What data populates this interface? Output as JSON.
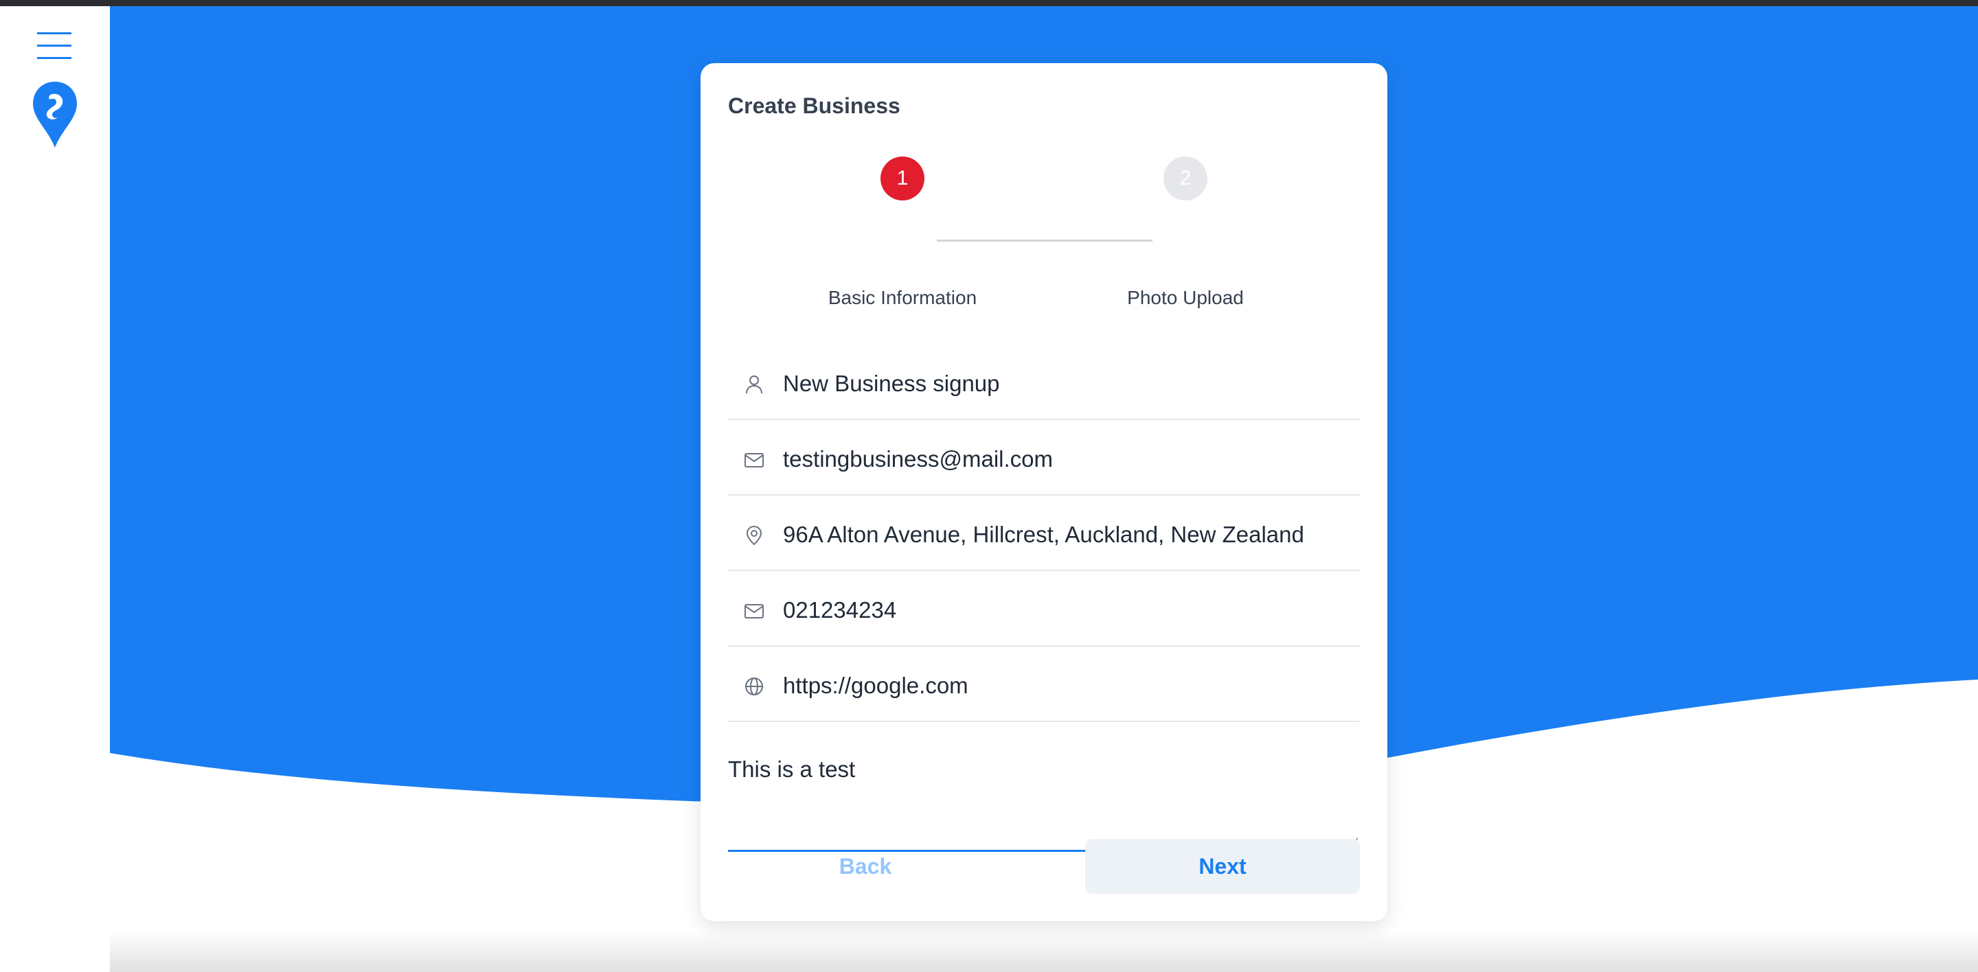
{
  "sidebar": {
    "menu_icon": "hamburger-menu-icon",
    "logo_icon": "map-pin-logo-icon"
  },
  "form": {
    "title": "Create Business",
    "steps": [
      {
        "number": "1",
        "label": "Basic Information",
        "state": "active"
      },
      {
        "number": "2",
        "label": "Photo Upload",
        "state": "inactive"
      }
    ],
    "fields": {
      "name": {
        "icon": "user-icon",
        "value": "New Business signup"
      },
      "email": {
        "icon": "mail-icon",
        "value": "testingbusiness@mail.com"
      },
      "address": {
        "icon": "location-pin-icon",
        "value": "96A Alton Avenue, Hillcrest, Auckland, New Zealand"
      },
      "phone": {
        "icon": "mail-icon",
        "value": "021234234"
      },
      "website": {
        "icon": "globe-icon",
        "value": "https://google.com"
      },
      "description": {
        "value": "This is a test"
      }
    },
    "buttons": {
      "back": "Back",
      "next": "Next"
    }
  },
  "colors": {
    "brand_blue": "#1a7ef2",
    "step_active": "#e11d2e",
    "step_inactive": "#e5e7eb",
    "back_disabled": "#93c5fd",
    "next_bg": "#edf2f7"
  }
}
